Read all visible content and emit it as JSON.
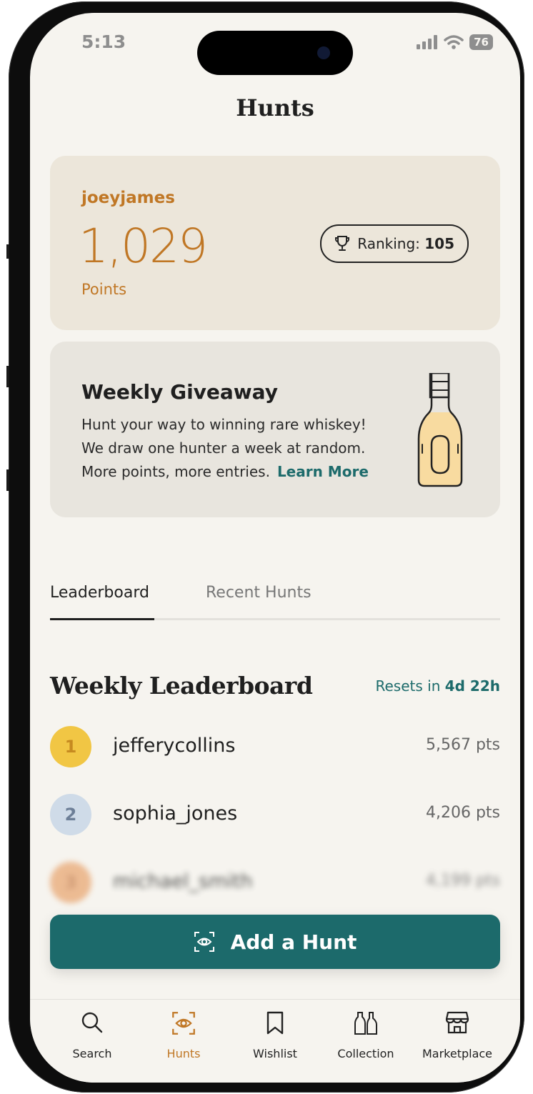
{
  "status_bar": {
    "time": "5:13",
    "battery": "76"
  },
  "header": {
    "title": "Hunts"
  },
  "points_card": {
    "username": "joeyjames",
    "points": "1,029",
    "points_label": "Points",
    "ranking_label": "Ranking:",
    "ranking_value": "105"
  },
  "giveaway": {
    "title": "Weekly Giveaway",
    "line1": "Hunt your way to winning rare whiskey!",
    "line2": "We draw one hunter a week at random.",
    "line3": "More points, more entries.",
    "learn_more": "Learn More"
  },
  "tabs": [
    {
      "label": "Leaderboard",
      "active": true
    },
    {
      "label": "Recent Hunts",
      "active": false
    }
  ],
  "leaderboard": {
    "title": "Weekly Leaderboard",
    "reset_label": "Resets in",
    "reset_value": "4d 22h",
    "rows": [
      {
        "rank": "1",
        "name": "jefferycollins",
        "points": "5,567 pts"
      },
      {
        "rank": "2",
        "name": "sophia_jones",
        "points": "4,206 pts"
      },
      {
        "rank": "3",
        "name": "michael_smith",
        "points": "4,199 pts"
      }
    ]
  },
  "add_hunt": {
    "label": "Add a Hunt"
  },
  "nav": [
    {
      "label": "Search",
      "icon": "search-icon",
      "active": false
    },
    {
      "label": "Hunts",
      "icon": "eye-scan-icon",
      "active": true
    },
    {
      "label": "Wishlist",
      "icon": "bookmark-icon",
      "active": false
    },
    {
      "label": "Collection",
      "icon": "bottles-icon",
      "active": false
    },
    {
      "label": "Marketplace",
      "icon": "storefront-icon",
      "active": false
    }
  ],
  "colors": {
    "accent": "#c07725",
    "teal": "#1c6a6b",
    "background": "#f6f4ef"
  }
}
